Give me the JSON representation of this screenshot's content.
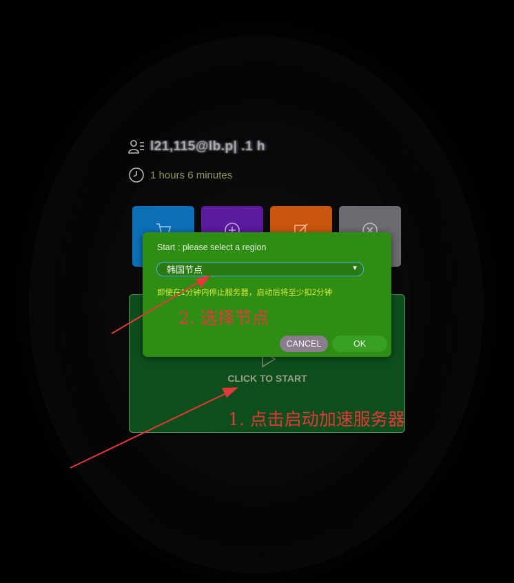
{
  "user": {
    "username": "l21,115@lb.p| .1 h",
    "usage_time": "1 hours 6 minutes"
  },
  "tiles": [
    {
      "icon": "cart-icon",
      "color": "#0c6fb8"
    },
    {
      "icon": "plus-circle-icon",
      "color": "#5c1a9c"
    },
    {
      "icon": "edit-icon",
      "color": "#c9560f"
    },
    {
      "icon": "close-circle-icon",
      "color": "#6e6a72"
    }
  ],
  "start_panel": {
    "label": "CLICK TO START"
  },
  "dialog": {
    "title": "Start : please select a region",
    "selected_region": "韩国节点",
    "note": "即使在1分钟内停止服务器，启动后将至少扣2分钟",
    "cancel_label": "CANCEL",
    "ok_label": "OK"
  },
  "annotations": {
    "step2": "2. 选择节点",
    "step1": "1. 点击启动加速服务器"
  },
  "colors": {
    "dialog_bg": "#2e8d12",
    "panel_bg": "#0c4f1c",
    "annotation": "#e23a3a"
  }
}
